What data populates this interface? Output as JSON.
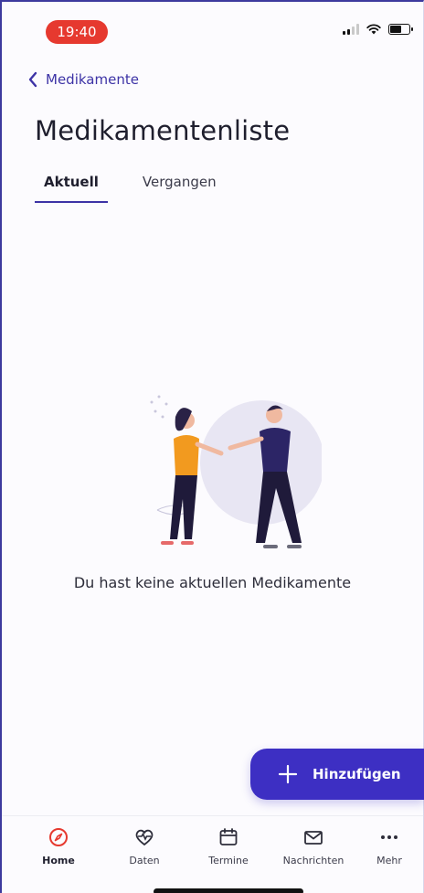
{
  "status_bar": {
    "time": "19:40"
  },
  "nav": {
    "back_label": "Medikamente"
  },
  "page": {
    "title": "Medikamentenliste"
  },
  "tabs": [
    {
      "label": "Aktuell",
      "active": true
    },
    {
      "label": "Vergangen",
      "active": false
    }
  ],
  "empty_state": {
    "message": "Du hast keine aktuellen Medikamente"
  },
  "fab": {
    "label": "Hinzufügen",
    "icon": "plus-icon"
  },
  "bottom_nav": [
    {
      "label": "Home",
      "icon": "compass-icon",
      "active": true
    },
    {
      "label": "Daten",
      "icon": "heart-pulse-icon",
      "active": false
    },
    {
      "label": "Termine",
      "icon": "calendar-icon",
      "active": false
    },
    {
      "label": "Nachrichten",
      "icon": "mail-icon",
      "active": false
    },
    {
      "label": "Mehr",
      "icon": "more-dots-icon",
      "active": false
    }
  ],
  "colors": {
    "accent": "#3d2fc3",
    "time_pill": "#e6392f",
    "home_active": "#e6392f"
  }
}
